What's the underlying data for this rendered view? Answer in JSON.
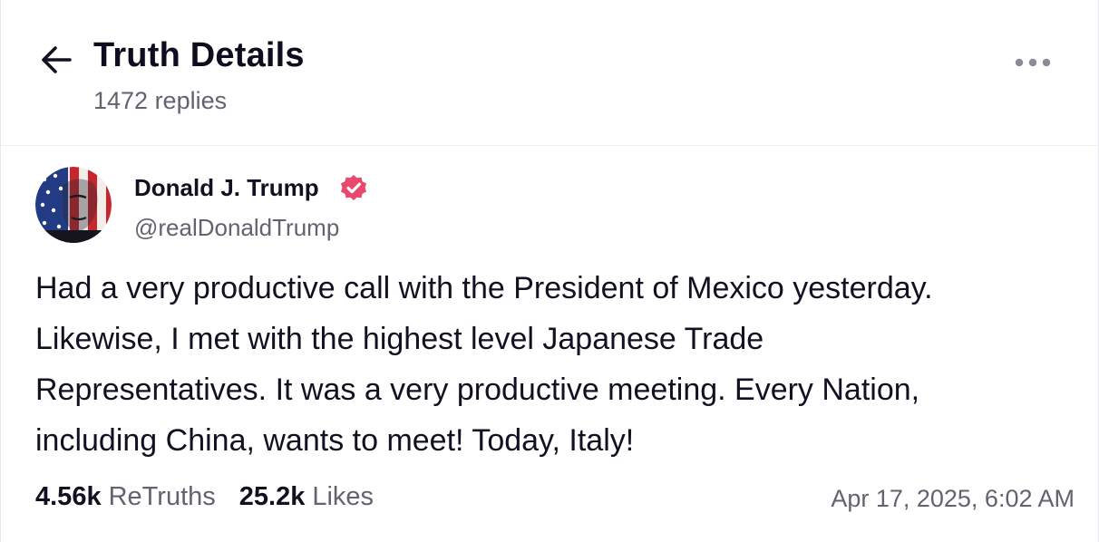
{
  "header": {
    "title": "Truth Details",
    "replies": "1472 replies",
    "back_icon": "arrow-left-icon",
    "more_icon": "more-horizontal-icon"
  },
  "post": {
    "author": {
      "name": "Donald J. Trump",
      "handle": "@realDonaldTrump",
      "verified_icon": "verified-badge-icon",
      "avatar": "avatar-image"
    },
    "body_lines": [
      "Had a very productive call with the President of Mexico yesterday.",
      "Likewise, I met with the highest level Japanese Trade",
      "Representatives. It was a very productive meeting. Every Nation,",
      "including China, wants to meet! Today, Italy!"
    ],
    "stats": {
      "retruths_count": "4.56k",
      "retruths_label": "ReTruths",
      "likes_count": "25.2k",
      "likes_label": "Likes"
    },
    "timestamp": "Apr 17, 2025, 6:02 AM"
  },
  "colors": {
    "text_primary": "#111122",
    "text_secondary": "#62636f",
    "verified_badge": "#e8496c",
    "icon_gray": "#8a8b96"
  }
}
